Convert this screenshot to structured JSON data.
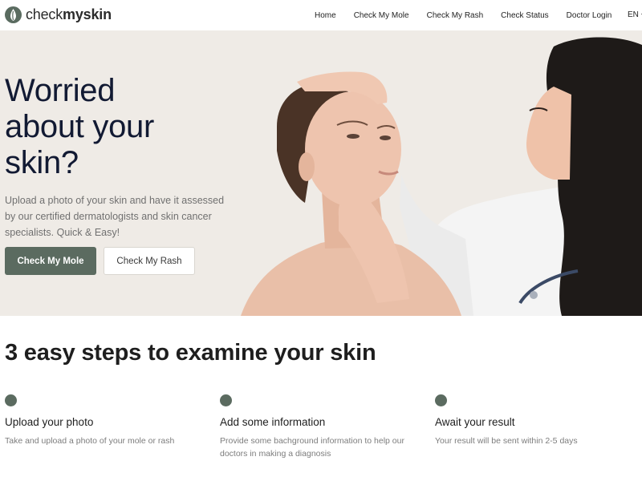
{
  "header": {
    "logo": {
      "part1": "check",
      "part2": "my",
      "part3": "skin"
    },
    "nav": [
      "Home",
      "Check My Mole",
      "Check My Rash",
      "Check Status",
      "Doctor Login"
    ],
    "language": "EN"
  },
  "hero": {
    "title_line1": "Worried",
    "title_line2": "about your",
    "title_line3": "skin?",
    "description": "Upload a photo of your skin and have it assessed by our certified dermatologists and skin cancer specialists. Quick & Easy!",
    "primary_button": "Check My Mole",
    "secondary_button": "Check My Rash"
  },
  "steps": {
    "title": "3 easy steps to examine your skin",
    "items": [
      {
        "title": "Upload your photo",
        "text": "Take and upload a photo of your mole or rash"
      },
      {
        "title": "Add some information",
        "text": "Provide some bachground information to help our doctors in making a diagnosis"
      },
      {
        "title": "Await your result",
        "text": "Your result will be sent within 2-5 days"
      }
    ]
  },
  "colors": {
    "accent": "#5b6b60",
    "hero_background": "#efebe6",
    "heading_navy": "#121a33"
  },
  "icons": [
    "logo-icon",
    "chevron-down-icon",
    "step-dot-icon"
  ]
}
